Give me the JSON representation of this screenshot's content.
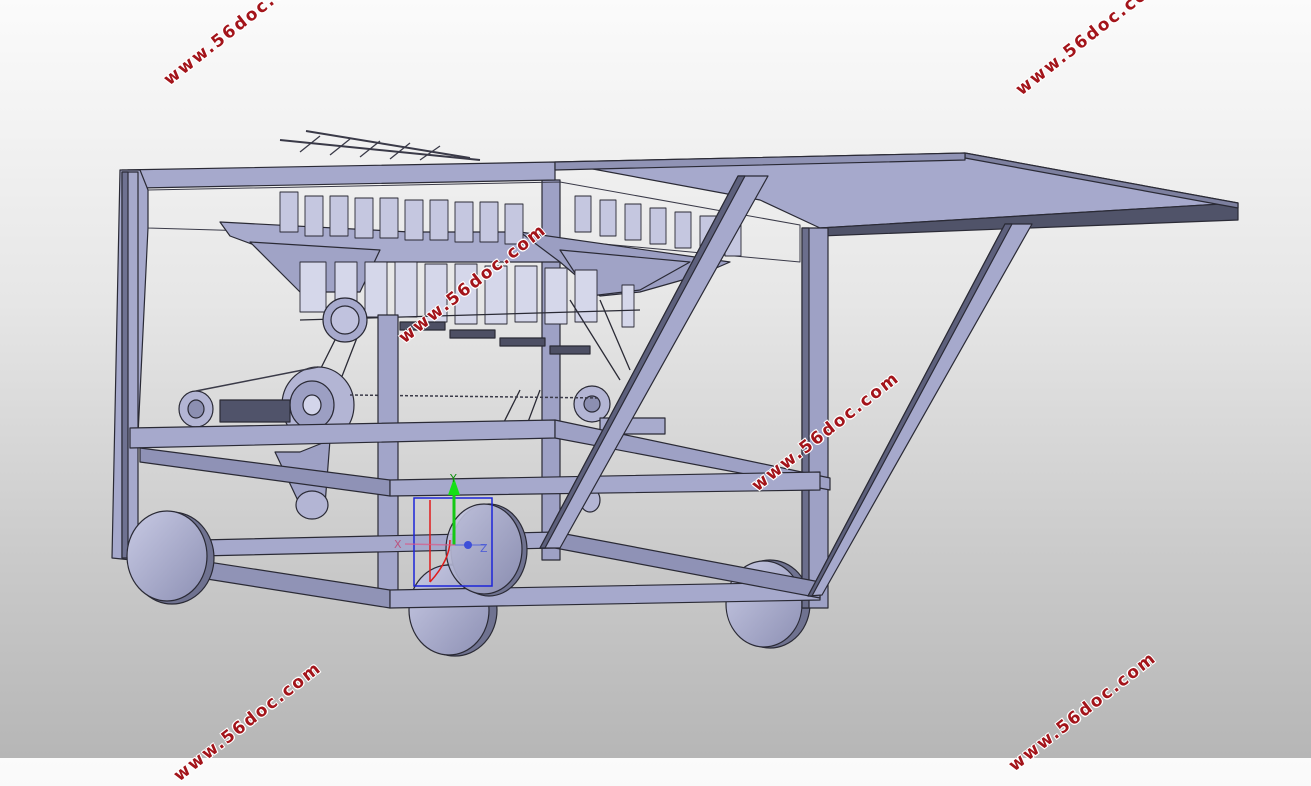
{
  "watermark": {
    "text": "www.56doc.com",
    "color": "#a3141a"
  },
  "triad": {
    "x_label": "X",
    "y_label": "Y",
    "z_label": "Z"
  },
  "colors": {
    "part_fill": "#a9acd0",
    "part_dark": "#4d4f64",
    "edge": "#2a2a35"
  }
}
